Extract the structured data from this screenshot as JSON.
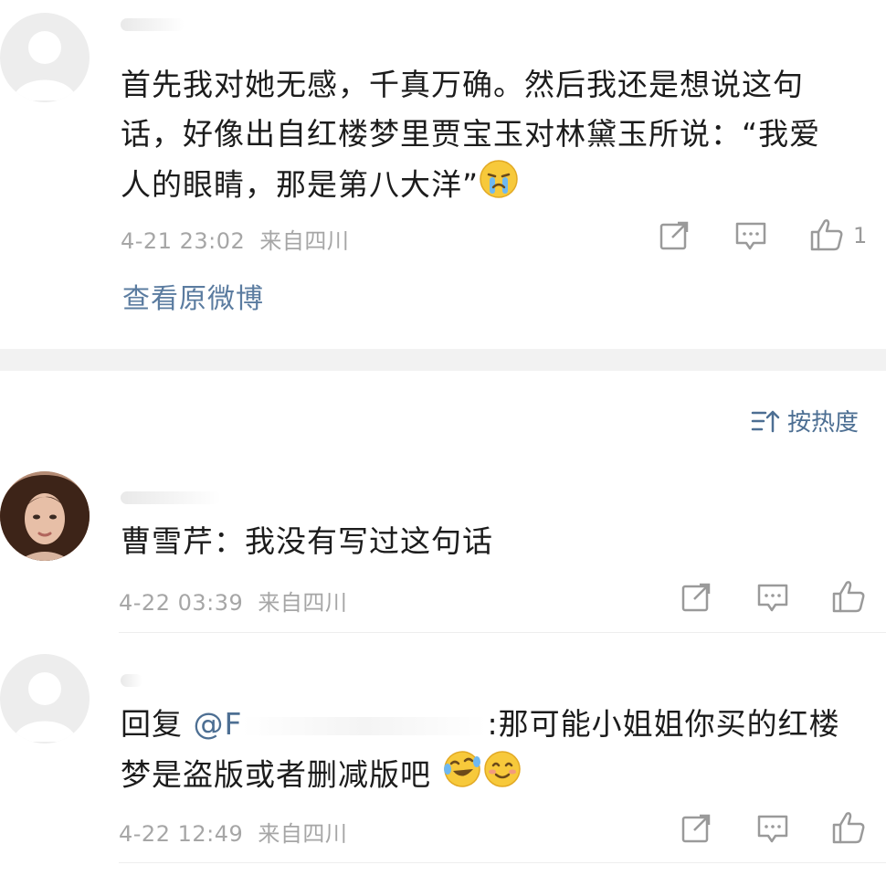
{
  "comments": [
    {
      "text": "首先我对她无感，千真万确。然后我还是想说这句话，好像出自红楼梦里贾宝玉对林黛玉所说：“我爱人的眼睛，那是第八大洋”",
      "time": "4-21 23:02",
      "location": "来自四川",
      "like_count": "1",
      "emoji": "crying-emoji"
    },
    {
      "text": "曹雪芹：我没有写过这句话",
      "time": "4-22 03:39",
      "location": "来自四川"
    },
    {
      "reply_prefix": "回复",
      "mention": "@F",
      "text": ":那可能小姐姐你买的红楼梦是盗版或者删减版吧",
      "time": "4-22 12:49",
      "location": "来自四川",
      "emoji": [
        "laughing-tears-emoji",
        "smiling-emoji"
      ]
    }
  ],
  "view_original_link": "查看原微博",
  "sort": {
    "label": "按热度",
    "icon": "sort-icon"
  },
  "colors": {
    "link": "#5b7ca0",
    "meta": "#a6a6a6",
    "band": "#f2f2f2"
  }
}
